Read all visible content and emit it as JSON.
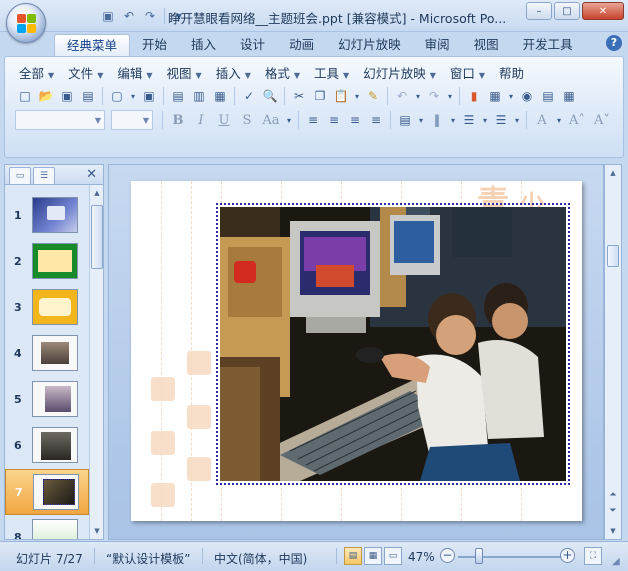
{
  "window": {
    "title": "睁开慧眼看网络__主题班会.ppt [兼容模式] - Microsoft Po...",
    "minimize": "–",
    "maximize": "□",
    "close": "✕"
  },
  "quick_access": {
    "icons": [
      "save-icon",
      "undo-icon",
      "redo-icon",
      "customize-icon"
    ],
    "glyphs": [
      "▣",
      "↶",
      "↷",
      "▾"
    ]
  },
  "tabs": [
    {
      "label": "经典菜单",
      "active": true
    },
    {
      "label": "开始"
    },
    {
      "label": "插入"
    },
    {
      "label": "设计"
    },
    {
      "label": "动画"
    },
    {
      "label": "幻灯片放映"
    },
    {
      "label": "审阅"
    },
    {
      "label": "视图"
    },
    {
      "label": "开发工具"
    }
  ],
  "help": "?",
  "menus": [
    "全部",
    "文件",
    "编辑",
    "视图",
    "插入",
    "格式",
    "工具",
    "幻灯片放映",
    "窗口",
    "帮助"
  ],
  "toolbar1": {
    "glyphs": [
      "□",
      "📂",
      "▣",
      "▤",
      "▢",
      "▾",
      "▣",
      "▤",
      "▥",
      "▦",
      "✓",
      "🔍",
      "✂",
      "❐",
      "📋",
      "▾",
      "✎",
      "↶",
      "▾",
      "↷",
      "▾",
      "▮",
      "▦",
      "▾",
      "◉",
      "▤",
      "▦"
    ]
  },
  "toolbar2": {
    "bold": "B",
    "italic": "I",
    "underline": "U",
    "strike": "S",
    "case": "Aa",
    "align": [
      "≡",
      "≡",
      "≡",
      "≡"
    ],
    "extra": [
      "▤",
      "▾",
      "‖",
      "▾",
      "☰",
      "▾",
      "☰",
      "▾",
      "A",
      "▾",
      "A˄",
      "A˅"
    ]
  },
  "left_panel": {
    "tab_slides": "▭",
    "tab_outline": "☰",
    "close": "✕",
    "slides": [
      {
        "num": "1"
      },
      {
        "num": "2"
      },
      {
        "num": "3"
      },
      {
        "num": "4"
      },
      {
        "num": "5"
      },
      {
        "num": "6"
      },
      {
        "num": "7",
        "selected": true
      },
      {
        "num": "8"
      }
    ]
  },
  "slide": {
    "deco_chars": [
      "青",
      "少"
    ]
  },
  "status": {
    "slide_info": "幻灯片 7/27",
    "template": "“默认设计模板”",
    "language": "中文(简体，中国)",
    "zoom": "47%",
    "zoom_level_percent": 47,
    "zoom_out": "−",
    "zoom_in": "+"
  },
  "colors": {
    "accent": "#15428b",
    "selected_slide": "#f0a641",
    "photo_border": "#2a2aa8"
  }
}
